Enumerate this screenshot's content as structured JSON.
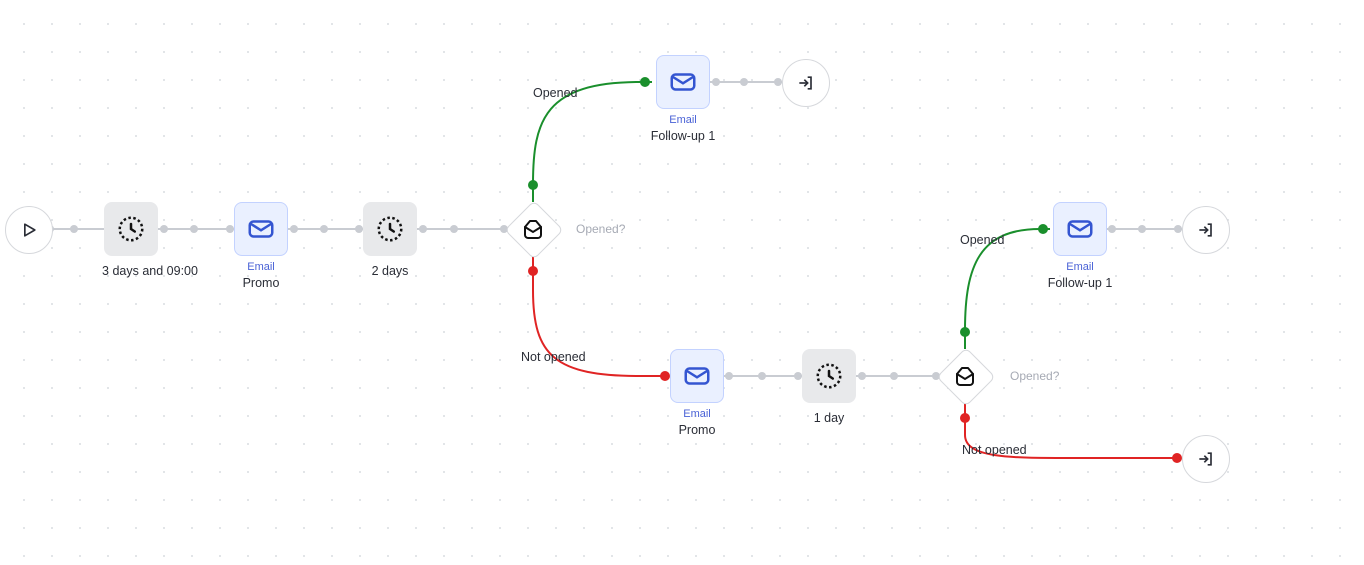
{
  "types": {
    "email": "Email"
  },
  "start": {},
  "wait1": {
    "label": "3 days and 09:00"
  },
  "email1": {
    "name": "Promo"
  },
  "wait2": {
    "label": "2 days"
  },
  "cond1": {
    "label": "Opened?",
    "yes": "Opened",
    "no": "Not opened"
  },
  "email_fu1a": {
    "name": "Follow-up 1"
  },
  "exit_a": {},
  "email2": {
    "name": "Promo"
  },
  "wait3": {
    "label": "1 day"
  },
  "cond2": {
    "label": "Opened?",
    "yes": "Opened",
    "no": "Not opened"
  },
  "email_fu1b": {
    "name": "Follow-up 1"
  },
  "exit_b": {},
  "exit_c": {}
}
